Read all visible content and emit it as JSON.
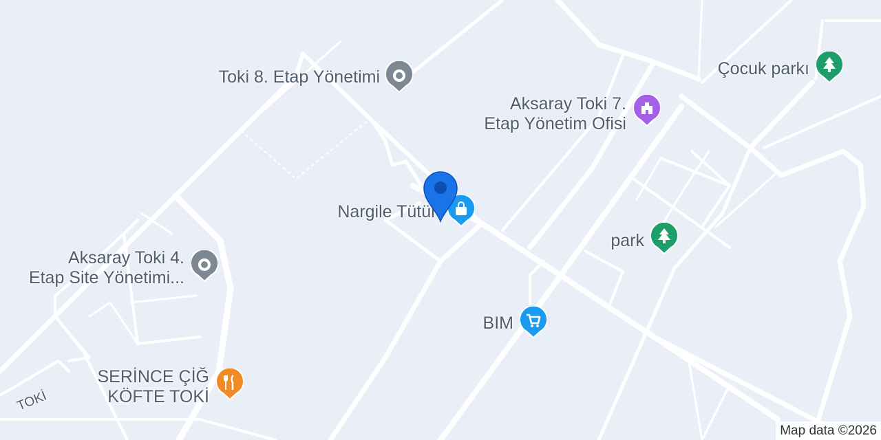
{
  "map": {
    "background": "#e9eef7",
    "road_color": "#ffffff",
    "attribution": "Map data ©2026",
    "road_labels": [
      {
        "id": "toki",
        "text": "TOKİ"
      }
    ],
    "pois": [
      {
        "id": "toki8",
        "name_lines": [
          "Toki 8. Etap Yönetimi"
        ],
        "category": "place",
        "icon": "location-dot-icon",
        "color": "#7d8894"
      },
      {
        "id": "toki7",
        "name_lines": [
          "Aksaray Toki 7.",
          "Etap Yönetim Ofisi"
        ],
        "category": "civic",
        "icon": "building-icon",
        "color": "#a560e8"
      },
      {
        "id": "cocuk",
        "name_lines": [
          "Çocuk parkı"
        ],
        "category": "park",
        "icon": "tree-icon",
        "color": "#1e9e6a"
      },
      {
        "id": "nargile",
        "name_lines": [
          "Nargile Tütün"
        ],
        "category": "shopping",
        "icon": "shopping-bag-icon",
        "color": "#1a9bef"
      },
      {
        "id": "park",
        "name_lines": [
          "park"
        ],
        "category": "park",
        "icon": "tree-icon",
        "color": "#1e9e6a"
      },
      {
        "id": "toki4",
        "name_lines": [
          "Aksaray Toki 4.",
          "Etap Site Yönetimi..."
        ],
        "category": "place",
        "icon": "location-dot-icon",
        "color": "#7d8894"
      },
      {
        "id": "bim",
        "name_lines": [
          "BIM"
        ],
        "category": "grocery",
        "icon": "cart-icon",
        "color": "#1a9bef"
      },
      {
        "id": "serince",
        "name_lines": [
          "SERİNCE ÇİĞ",
          "KÖFTE TOKİ"
        ],
        "category": "restaurant",
        "icon": "fork-knife-icon",
        "color": "#f28b24"
      }
    ],
    "selected_pin": {
      "icon": "map-pin-icon",
      "color": "#1a73e8"
    }
  }
}
